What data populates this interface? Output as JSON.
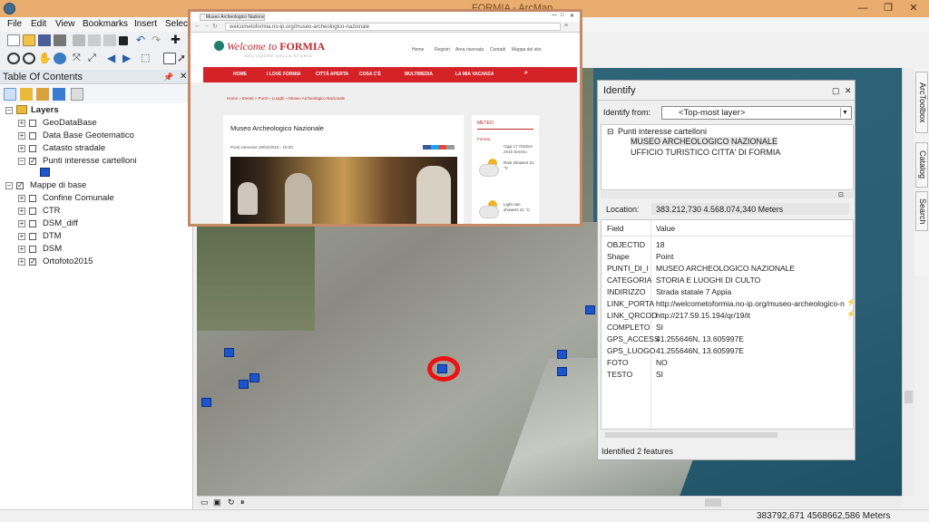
{
  "app": {
    "title": "FORMIA - ArcMap"
  },
  "menu": {
    "items": [
      "File",
      "Edit",
      "View",
      "Bookmarks",
      "Insert",
      "Selecti"
    ]
  },
  "toc": {
    "title": "Table Of Contents",
    "root": "Layers",
    "layers": [
      {
        "label": "GeoDataBase",
        "checked": false
      },
      {
        "label": "Data Base Geotematico",
        "checked": false
      },
      {
        "label": "Catasto stradale",
        "checked": false
      },
      {
        "label": "Punti interesse cartelloni",
        "checked": true
      }
    ],
    "group": {
      "label": "Mappe di base",
      "checked": true
    },
    "group_layers": [
      {
        "label": "Confine Comunale",
        "checked": false
      },
      {
        "label": "CTR",
        "checked": false
      },
      {
        "label": "DSM_diff",
        "checked": false
      },
      {
        "label": "DTM",
        "checked": false
      },
      {
        "label": "DSM",
        "checked": false
      },
      {
        "label": "Ortofoto2015",
        "checked": true
      }
    ]
  },
  "browser": {
    "tab": "Museo Archeologico Nazionale",
    "url": "welcometoformia.no-ip.org/museo-archeologico-nazionale",
    "logo_script": "Welcome to",
    "logo_city": "FORMIA",
    "tagline": "NEL CUORE DELLA STORIA",
    "top_links": [
      "Home",
      "Registri",
      "Area riservata",
      "Contatti",
      "Mappa del sito"
    ],
    "nav": [
      "HOME",
      "I LOVE FORMIA",
      "CITTÀ APERTA",
      "COSA C'È",
      "MULTIMEDIA",
      "LA MIA VACANZA"
    ],
    "breadcrumb": "Home » Eventi » Punti » Luoghi » Museo Archeologico Nazionale",
    "article_title": "Museo Archeologico Nazionale",
    "article_meta": "Punti interesse 28/04/2015 - 10:30",
    "weather_title": "METEO",
    "weather_city": "Formia",
    "weather_date": "Oggi 17 Ottobre 2015 Sereno",
    "weather_items": [
      "Rain showers 21 °C",
      "Light rain showers 21 °C"
    ]
  },
  "identify": {
    "title": "Identify",
    "from_label": "Identify from:",
    "from_value": "<Top-most layer>",
    "tree_root": "Punti interesse cartelloni",
    "tree_items": [
      "MUSEO ARCHEOLOGICO NAZIONALE",
      "UFFICIO TURISTICO CITTA' DI FORMIA"
    ],
    "location_label": "Location:",
    "location_value": "383.212,730  4.568.074,340 Meters",
    "col_field": "Field",
    "col_value": "Value",
    "fields": [
      {
        "k": "OBJECTID",
        "v": "18"
      },
      {
        "k": "Shape",
        "v": "Point"
      },
      {
        "k": "PUNTI_DI_I",
        "v": "MUSEO ARCHEOLOGICO NAZIONALE"
      },
      {
        "k": "CATEGORIA",
        "v": "STORIA E LUOGHI DI CULTO"
      },
      {
        "k": "INDIRIZZO",
        "v": "Strada statale 7 Appia"
      },
      {
        "k": "LINK_PORTA",
        "v": "http://welcometoformia.no-ip.org/museo-archeologico-na"
      },
      {
        "k": "LINK_QRCOD",
        "v": "http://217.59.15.194/qr/19/it"
      },
      {
        "k": "COMPLETO",
        "v": "SI"
      },
      {
        "k": "GPS_ACCESS",
        "v": "41.255646N, 13.605997E"
      },
      {
        "k": "GPS_LUOGO",
        "v": "41.255646N, 13.605997E"
      },
      {
        "k": "FOTO",
        "v": "NO"
      },
      {
        "k": "TESTO",
        "v": "SI"
      }
    ],
    "status": "Identified 2 features"
  },
  "sidetabs": [
    "ArcToolbox",
    "Catalog",
    "Search"
  ],
  "status": {
    "coords": "383792,671  4568662,586 Meters"
  },
  "colors": {
    "titlebar": "#e8ad6f",
    "site_red": "#d42227",
    "point_blue": "#1c55c9",
    "highlight_red": "#e11111"
  }
}
